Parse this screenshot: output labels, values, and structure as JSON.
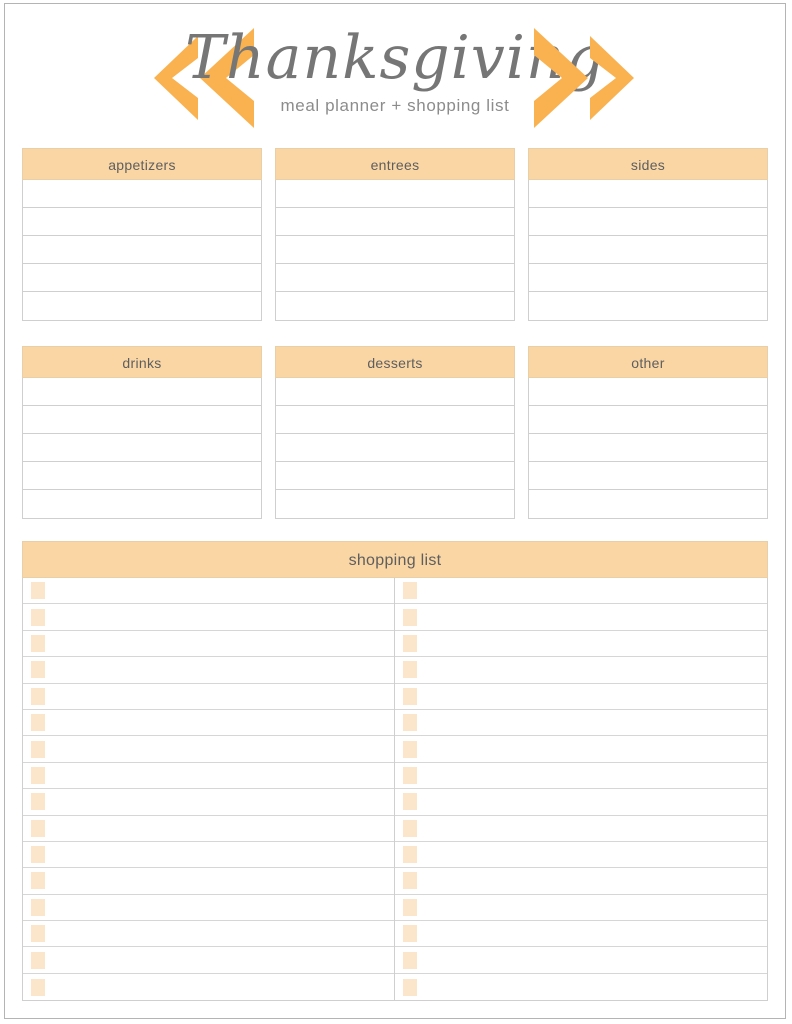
{
  "page": {
    "title_script": "Thanksgiving",
    "subtitle": "meal planner + shopping list",
    "border_color": "#b4b4b4",
    "background": "#ffffff"
  },
  "theme": {
    "chevron_color": "#F9B котор",
    "chevron_hex": "#F9B24F",
    "header_fill": "#FAD6A5",
    "checkbox_fill": "#FCE6CB",
    "text_color": "#5e5e5e",
    "rule_color": "#cfcfcf"
  },
  "decor": {
    "left_chevrons": "double-chevron-left-icon",
    "right_chevrons": "double-chevron-right-icon"
  },
  "categories": {
    "row_one": [
      {
        "label": "appetizers",
        "rows": 5
      },
      {
        "label": "entrees",
        "rows": 5
      },
      {
        "label": "sides",
        "rows": 5
      }
    ],
    "row_two": [
      {
        "label": "drinks",
        "rows": 5
      },
      {
        "label": "desserts",
        "rows": 5
      },
      {
        "label": "other",
        "rows": 5
      }
    ]
  },
  "shopping_list": {
    "label": "shopping list",
    "columns": 2,
    "rows_per_column": 16,
    "checkbox": "checkbox-square-icon"
  }
}
